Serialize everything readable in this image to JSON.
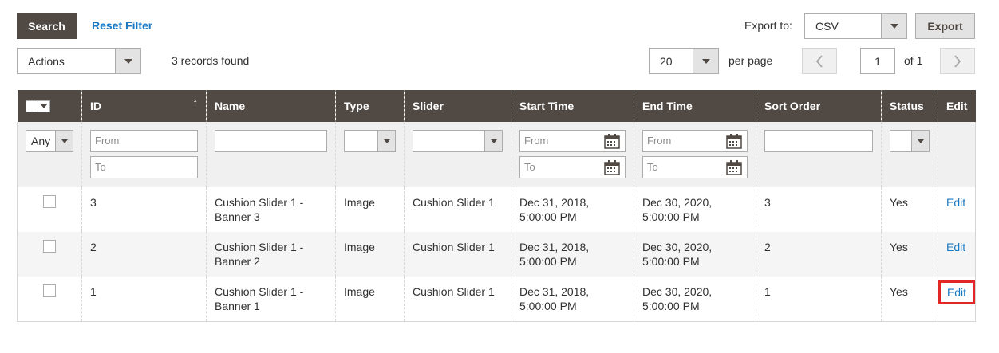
{
  "toolbar": {
    "search_label": "Search",
    "reset_filter_label": "Reset Filter",
    "export_to_label": "Export to:",
    "export_format": "CSV",
    "export_button_label": "Export",
    "actions_label": "Actions",
    "records_found": "3 records found",
    "per_page_value": "20",
    "per_page_label": "per page",
    "page_value": "1",
    "page_of": "of 1"
  },
  "columns": [
    "ID",
    "Name",
    "Type",
    "Slider",
    "Start Time",
    "End Time",
    "Sort Order",
    "Status",
    "Edit"
  ],
  "filters": {
    "any_label": "Any",
    "from_placeholder": "From",
    "to_placeholder": "To"
  },
  "rows": [
    {
      "id": "3",
      "name": "Cushion Slider 1 - Banner 3",
      "type": "Image",
      "slider": "Cushion Slider 1",
      "start": "Dec 31, 2018, 5:00:00 PM",
      "end": "Dec 30, 2020, 5:00:00 PM",
      "sort_order": "3",
      "status": "Yes",
      "edit": "Edit"
    },
    {
      "id": "2",
      "name": "Cushion Slider 1 - Banner 2",
      "type": "Image",
      "slider": "Cushion Slider 1",
      "start": "Dec 31, 2018, 5:00:00 PM",
      "end": "Dec 30, 2020, 5:00:00 PM",
      "sort_order": "2",
      "status": "Yes",
      "edit": "Edit"
    },
    {
      "id": "1",
      "name": "Cushion Slider 1 - Banner 1",
      "type": "Image",
      "slider": "Cushion Slider 1",
      "start": "Dec 31, 2018, 5:00:00 PM",
      "end": "Dec 30, 2020, 5:00:00 PM",
      "sort_order": "1",
      "status": "Yes",
      "edit": "Edit"
    }
  ],
  "icons": {
    "sort": "sort-ascending-icon",
    "calendar": "calendar-icon",
    "prev": "chevron-left-icon",
    "next": "chevron-right-icon"
  },
  "colors": {
    "header_bg": "#514943",
    "link": "#1979c3",
    "highlight": "#e22626"
  }
}
